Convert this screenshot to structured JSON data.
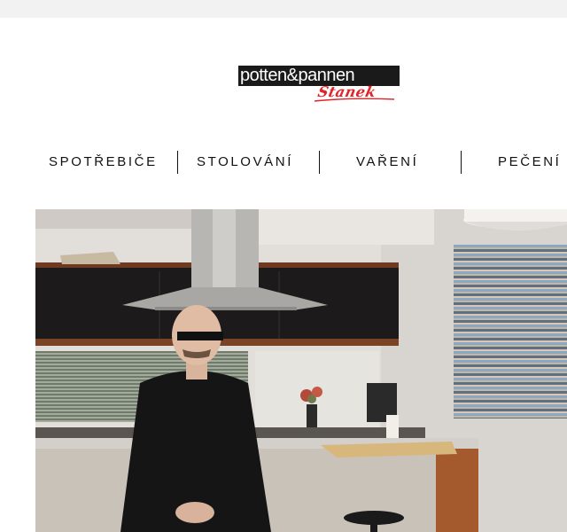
{
  "header": {
    "logo_text": "potten&pannen",
    "logo_sub": "Stanek"
  },
  "nav": {
    "items": [
      {
        "label": "SPOTŘEBIČE"
      },
      {
        "label": "STOLOVÁNÍ"
      },
      {
        "label": "VAŘENÍ"
      },
      {
        "label": "PEČENÍ"
      }
    ]
  },
  "hero": {
    "image": "kitchen-photo"
  },
  "colors": {
    "brand_red": "#e3232a",
    "logo_black": "#1a1a1a",
    "topbar": "#f2f2f2"
  }
}
